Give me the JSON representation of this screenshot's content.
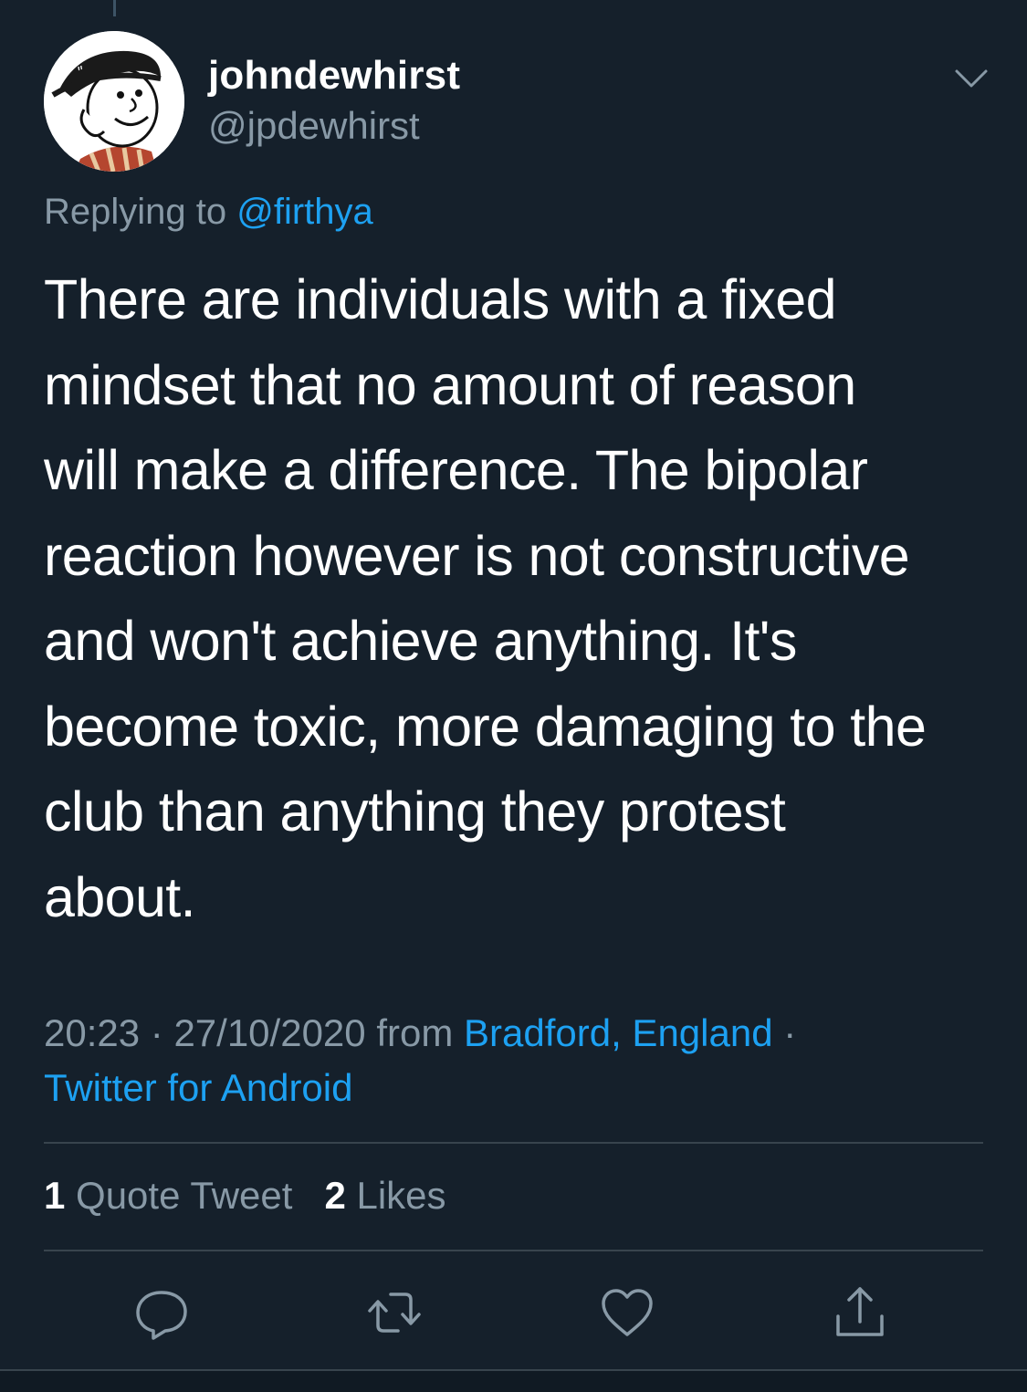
{
  "tweet": {
    "author": {
      "display_name": "johndewhirst",
      "handle": "@jpdewhirst",
      "avatar_icon": "cartoon-boy-avatar"
    },
    "replying_to": {
      "prefix": "Replying to",
      "mention": "@firthya"
    },
    "text_lines": [
      "There are individuals with a fixed",
      "mindset that no amount of reason",
      "will make a difference. The bipolar",
      "reaction however is not constructive",
      "and won't achieve anything. It's",
      "become toxic, more damaging to the",
      "club than anything they protest",
      "about."
    ],
    "meta": {
      "time": "20:23",
      "sep1": " · ",
      "date": "27/10/2020",
      "from_label": " from ",
      "location": "Bradford, England",
      "sep2": " ·",
      "source": "Twitter for Android"
    },
    "stats": {
      "quote_count": "1",
      "quote_label": "Quote Tweet",
      "likes_count": "2",
      "likes_label": "Likes"
    },
    "actions": {
      "reply_icon": "reply-icon",
      "retweet_icon": "retweet-icon",
      "like_icon": "heart-icon",
      "share_icon": "share-icon"
    }
  },
  "colors": {
    "background": "#15202b",
    "text_primary": "#ffffff",
    "text_secondary": "#8899a6",
    "link": "#1da1f2",
    "divider": "#38444d"
  }
}
